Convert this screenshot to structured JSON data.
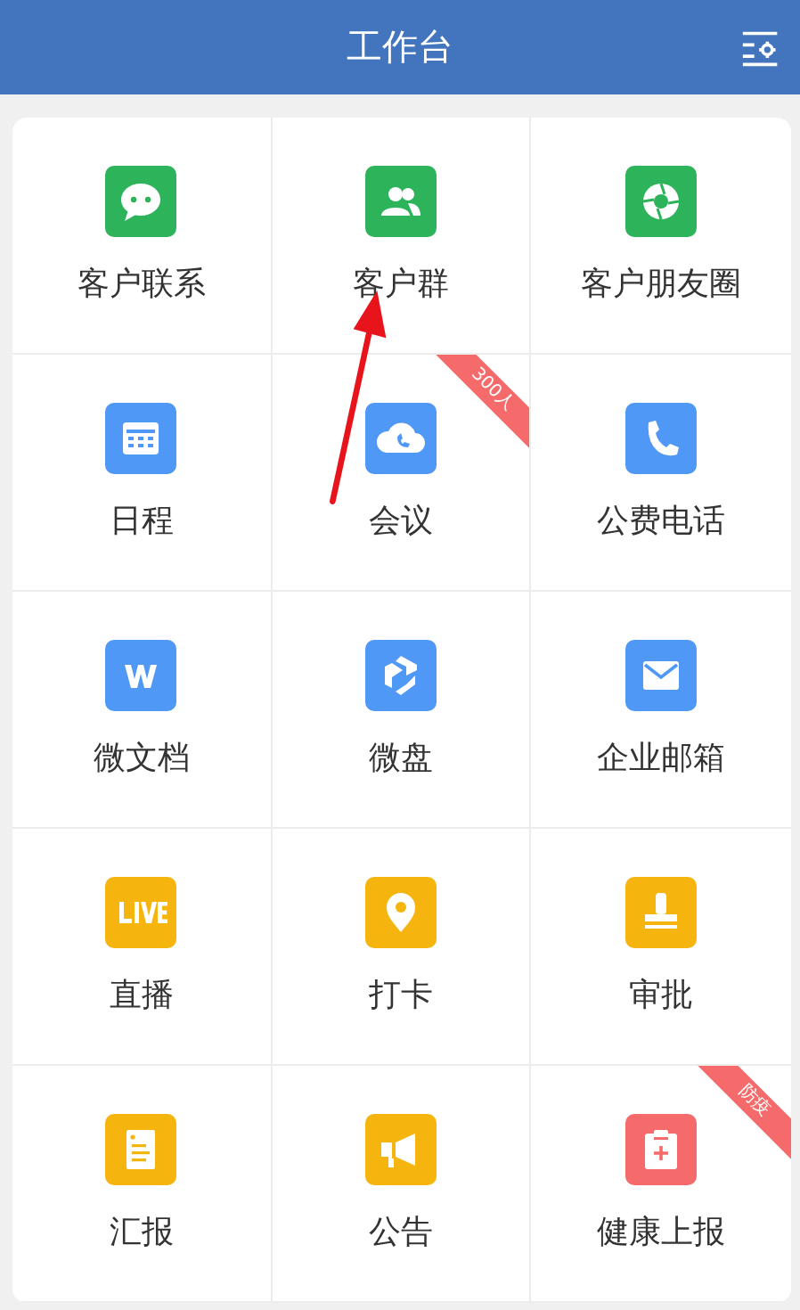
{
  "header": {
    "title": "工作台"
  },
  "apps": [
    {
      "label": "客户联系",
      "color": "#2db35a"
    },
    {
      "label": "客户群",
      "color": "#2db35a"
    },
    {
      "label": "客户朋友圈",
      "color": "#2db35a"
    },
    {
      "label": "日程",
      "color": "#5098f5"
    },
    {
      "label": "会议",
      "color": "#5098f5",
      "badge": "300人"
    },
    {
      "label": "公费电话",
      "color": "#5098f5"
    },
    {
      "label": "微文档",
      "color": "#5098f5"
    },
    {
      "label": "微盘",
      "color": "#5098f5"
    },
    {
      "label": "企业邮箱",
      "color": "#5098f5"
    },
    {
      "label": "直播",
      "color": "#f6b50e"
    },
    {
      "label": "打卡",
      "color": "#f6b50e"
    },
    {
      "label": "审批",
      "color": "#f6b50e"
    },
    {
      "label": "汇报",
      "color": "#f6b50e"
    },
    {
      "label": "公告",
      "color": "#f6b50e"
    },
    {
      "label": "健康上报",
      "color": "#f56b6b",
      "badge": "防疫"
    }
  ]
}
